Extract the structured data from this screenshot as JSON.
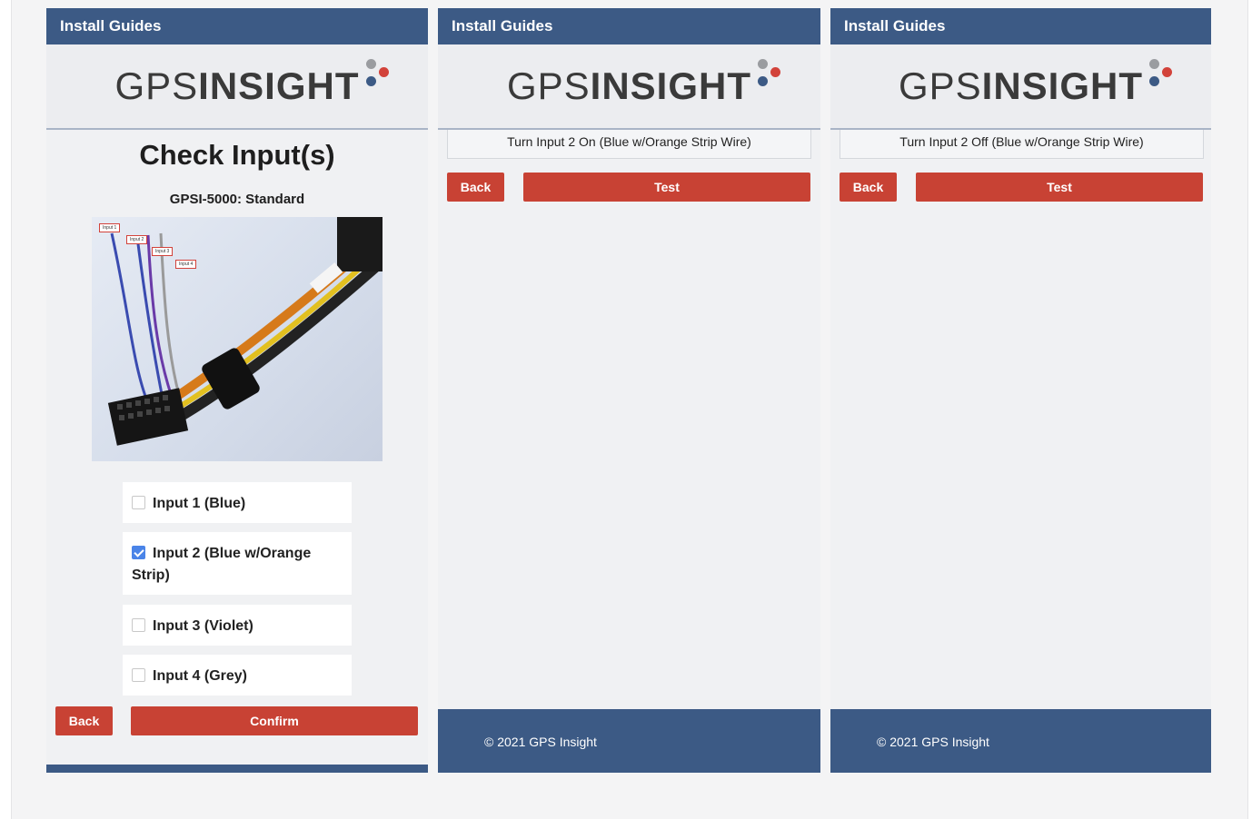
{
  "panels": [
    {
      "header": "Install Guides",
      "logo": {
        "part1": "GPS",
        "part2": "INSIGHT"
      },
      "title": "Check Input(s)",
      "subtitle": "GPSI-5000: Standard",
      "image_labels": [
        "Input 1",
        "Input 2",
        "Input 3",
        "Input 4"
      ],
      "options": [
        {
          "label": "Input 1 (Blue)",
          "checked": false
        },
        {
          "label": "Input 2 (Blue w/Orange Strip)",
          "checked": true
        },
        {
          "label": "Input 3 (Violet)",
          "checked": false
        },
        {
          "label": "Input 4 (Grey)",
          "checked": false
        }
      ],
      "back_label": "Back",
      "confirm_label": "Confirm"
    },
    {
      "header": "Install Guides",
      "logo": {
        "part1": "GPS",
        "part2": "INSIGHT"
      },
      "instruction": "Turn Input 2 On (Blue w/Orange Strip Wire)",
      "back_label": "Back",
      "test_label": "Test",
      "footer": "© 2021 GPS Insight"
    },
    {
      "header": "Install Guides",
      "logo": {
        "part1": "GPS",
        "part2": "INSIGHT"
      },
      "instruction": "Turn Input 2 Off (Blue w/Orange Strip Wire)",
      "back_label": "Back",
      "test_label": "Test",
      "footer": "© 2021 GPS Insight"
    }
  ],
  "colors": {
    "header": "#3c5a85",
    "button": "#c84234",
    "checkbox": "#4a84e8"
  }
}
